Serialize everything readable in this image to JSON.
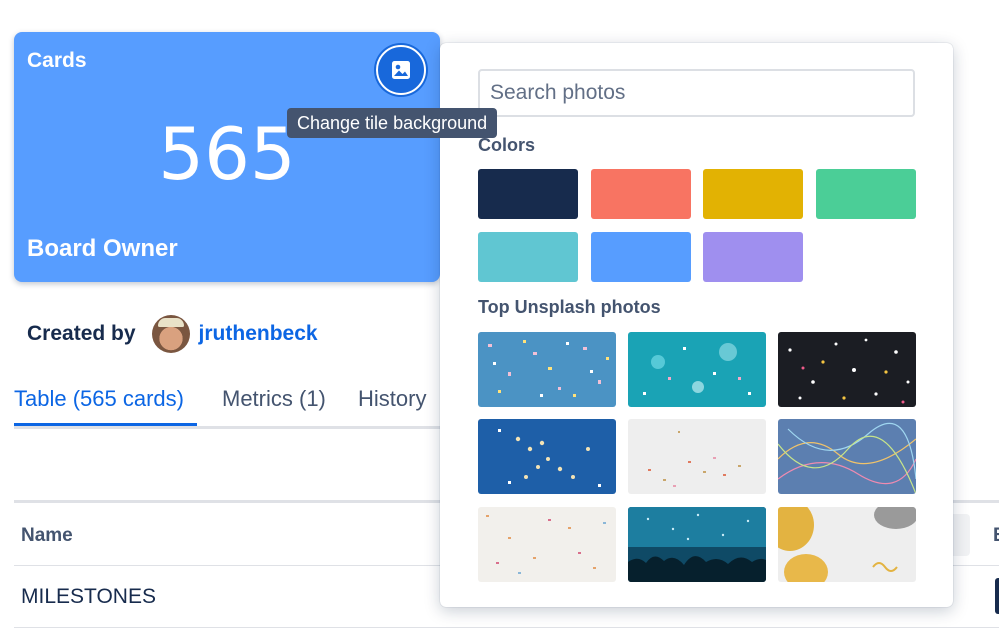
{
  "tile": {
    "title": "Cards",
    "value": "565",
    "footer": "Board Owner",
    "color": "#579dff",
    "background_button_icon": "image-icon",
    "tooltip": "Change tile background"
  },
  "created_by": {
    "label": "Created by",
    "user": "jruthenbeck"
  },
  "tabs": [
    {
      "label": "Table (565 cards)",
      "active": true
    },
    {
      "label": "Metrics (1)",
      "active": false
    },
    {
      "label": "History",
      "active": false
    }
  ],
  "table": {
    "columns": [
      "Name"
    ],
    "rows": [
      [
        "MILESTONES"
      ]
    ]
  },
  "picker": {
    "search_placeholder": "Search photos",
    "colors_title": "Colors",
    "colors": [
      "#172b4d",
      "#f87462",
      "#e2b203",
      "#4bce97",
      "#60c6d2",
      "#579dff",
      "#9f8fef"
    ],
    "photos_title": "Top Unsplash photos",
    "photos": [
      "blue-confetti",
      "teal-confetti-bokeh",
      "dark-confetti",
      "blue-stars-confetti",
      "white-confetti",
      "streamers-confetti",
      "white-sprinkles",
      "concert-crowd",
      "gold-balloons"
    ]
  }
}
